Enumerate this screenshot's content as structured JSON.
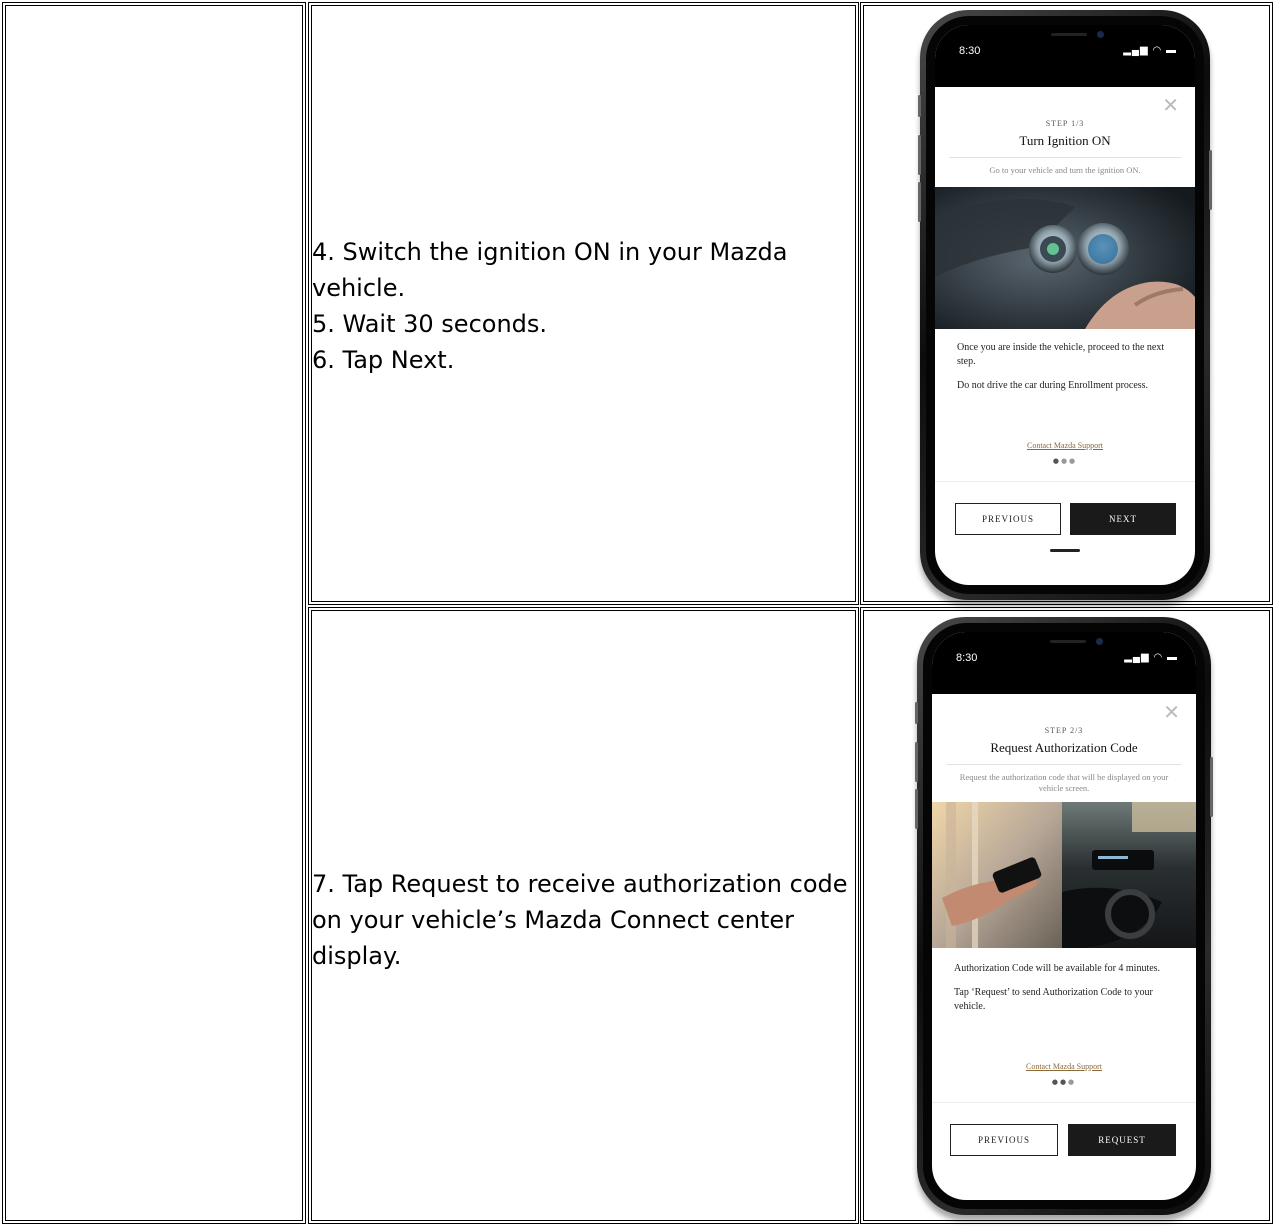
{
  "rows": [
    {
      "instructions": [
        "4. Switch the ignition ON in your Mazda",
        "vehicle.",
        "5. Wait 30 seconds.",
        "6. Tap Next."
      ],
      "phone": {
        "time": "8:30",
        "status": "..ıl ᯤ ▬",
        "step": "STEP 1/3",
        "title": "Turn Ignition ON",
        "subtitle": "Go to your vehicle and turn the ignition ON.",
        "body": [
          "Once you are inside the vehicle, proceed to the next step.",
          "Do not drive the car during Enrollment process."
        ],
        "link": "Contact Mazda Support",
        "page_indicator": {
          "current": 1,
          "total": 3
        },
        "left_button": "PREVIOUS",
        "right_button": "NEXT"
      }
    },
    {
      "instructions": [
        "7. Tap Request to receive authorization code",
        "on your vehicle’s Mazda Connect center",
        "display."
      ],
      "phone": {
        "time": "8:30",
        "status": "..ıl ᯤ ▬",
        "step": "STEP 2/3",
        "title": "Request Authorization Code",
        "subtitle": "Request the authorization code that will be displayed on your vehicle screen.",
        "body": [
          "Authorization Code will be available for 4 minutes.",
          "Tap ‘Request’ to send Authorization Code to your vehicle."
        ],
        "link": "Contact Mazda Support",
        "page_indicator": {
          "current": 2,
          "total": 3
        },
        "left_button": "PREVIOUS",
        "right_button": "REQUEST"
      }
    }
  ],
  "colors": {
    "accent_link": "#8a6a3a",
    "button_dark": "#1a1a1a"
  },
  "icons": [
    "close-icon",
    "signal-icon",
    "wifi-icon",
    "battery-icon"
  ]
}
